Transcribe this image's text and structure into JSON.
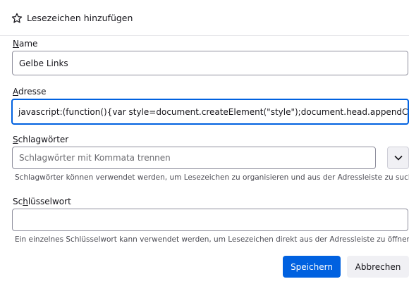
{
  "dialog": {
    "title": "Lesezeichen hinzufügen",
    "title_icon": "star-icon"
  },
  "name_field": {
    "label_pre": "",
    "label_mnemonic": "N",
    "label_post": "ame",
    "value": "Gelbe Links"
  },
  "address_field": {
    "label_pre": "",
    "label_mnemonic": "A",
    "label_post": "dresse",
    "value": "javascript:(function(){var style=document.createElement(\"style\");document.head.appendChild(style);style"
  },
  "tags_field": {
    "label_pre": "",
    "label_mnemonic": "S",
    "label_post": "chlagwörter",
    "placeholder": "Schlagwörter mit Kommata trennen",
    "hint": "Schlagwörter können verwendet werden, um Lesezeichen zu organisieren und aus der Adressleiste zu suchen.",
    "dropdown_icon": "chevron-down-icon"
  },
  "keyword_field": {
    "label_pre": "Sc",
    "label_mnemonic": "h",
    "label_post": "lüsselwort",
    "value": "",
    "hint": "Ein einzelnes Schlüsselwort kann verwendet werden, um Lesezeichen direkt aus der Adressleiste zu öffnen."
  },
  "buttons": {
    "save": "Speichern",
    "cancel": "Abbrechen"
  },
  "colors": {
    "accent": "#0061e0",
    "background": "#ffffff",
    "text": "#15141a"
  }
}
